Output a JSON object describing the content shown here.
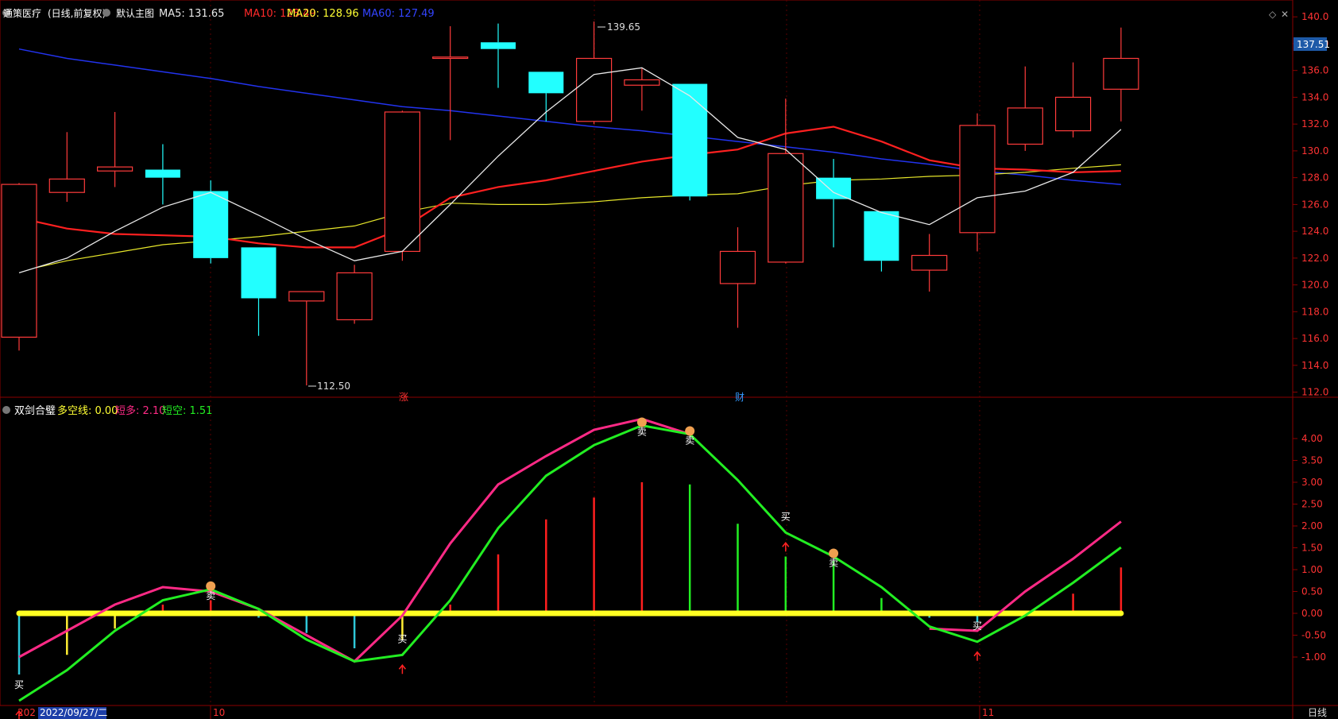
{
  "main": {
    "title": "通策医疗",
    "mode": "(日线,前复权)",
    "indicator_name": "默认主图",
    "ma_labels": [
      {
        "text": "MA5: 131.65",
        "color": "#e8e8e8"
      },
      {
        "text": "MA10: 128.49",
        "color": "#ff2a2a"
      },
      {
        "text": "MA20: 128.96",
        "color": "#ffff33"
      },
      {
        "text": "MA60: 127.49",
        "color": "#3344ff"
      }
    ],
    "price_tag": "137.51",
    "high_mark": "139.65",
    "low_mark": "112.50",
    "event_markers": [
      "涨",
      "财"
    ]
  },
  "sub": {
    "title": "双剑合璧",
    "labels": [
      {
        "text": "多空线: 0.00",
        "color": "#ffff33"
      },
      {
        "text": "短多: 2.10",
        "color": "#ff2a86"
      },
      {
        "text": "短空: 1.51",
        "color": "#22ee22"
      }
    ]
  },
  "signals": {
    "buy": "买",
    "sell": "卖"
  },
  "xaxis": {
    "first_label": "202",
    "cursor_date": "2022/09/27/二",
    "month_labels": [
      "10",
      "11"
    ],
    "period": "日线"
  },
  "chart_data": {
    "type": "candlestick",
    "price_ticks": [
      112,
      114,
      116,
      118,
      120,
      122,
      124,
      126,
      128,
      130,
      132,
      134,
      136,
      138,
      140
    ],
    "osc_ticks": [
      -1,
      -0.5,
      0,
      0.5,
      1,
      1.5,
      2,
      2.5,
      3,
      3.5,
      4
    ],
    "candles": [
      {
        "o": 116.1,
        "h": 127.6,
        "l": 115.1,
        "c": 127.5
      },
      {
        "o": 126.9,
        "h": 131.4,
        "l": 126.2,
        "c": 127.9
      },
      {
        "o": 128.5,
        "h": 132.9,
        "l": 127.3,
        "c": 128.8
      },
      {
        "o": 128.6,
        "h": 130.5,
        "l": 126.0,
        "c": 128.0
      },
      {
        "o": 127.0,
        "h": 127.8,
        "l": 121.6,
        "c": 122.0
      },
      {
        "o": 122.8,
        "h": 122.8,
        "l": 116.2,
        "c": 119.0
      },
      {
        "o": 118.8,
        "h": 119.5,
        "l": 112.5,
        "c": 119.5
      },
      {
        "o": 117.4,
        "h": 121.5,
        "l": 117.1,
        "c": 120.9
      },
      {
        "o": 122.5,
        "h": 133.0,
        "l": 121.8,
        "c": 132.9
      },
      {
        "o": 136.9,
        "h": 139.3,
        "l": 130.8,
        "c": 137.0
      },
      {
        "o": 138.1,
        "h": 139.5,
        "l": 134.7,
        "c": 137.6
      },
      {
        "o": 135.9,
        "h": 135.9,
        "l": 132.2,
        "c": 134.3
      },
      {
        "o": 132.2,
        "h": 139.65,
        "l": 132.0,
        "c": 136.9
      },
      {
        "o": 134.9,
        "h": 136.2,
        "l": 133.0,
        "c": 135.3
      },
      {
        "o": 135.0,
        "h": 135.0,
        "l": 126.3,
        "c": 126.6
      },
      {
        "o": 120.1,
        "h": 124.3,
        "l": 116.8,
        "c": 122.5
      },
      {
        "o": 121.7,
        "h": 133.9,
        "l": 121.6,
        "c": 129.8
      },
      {
        "o": 128.0,
        "h": 129.4,
        "l": 122.8,
        "c": 126.4
      },
      {
        "o": 125.5,
        "h": 125.5,
        "l": 121.0,
        "c": 121.8
      },
      {
        "o": 121.1,
        "h": 123.8,
        "l": 119.5,
        "c": 122.2
      },
      {
        "o": 123.9,
        "h": 132.8,
        "l": 122.5,
        "c": 131.9
      },
      {
        "o": 130.5,
        "h": 136.3,
        "l": 130.0,
        "c": 133.2
      },
      {
        "o": 131.5,
        "h": 136.6,
        "l": 131.0,
        "c": 134.0
      },
      {
        "o": 134.6,
        "h": 139.2,
        "l": 132.2,
        "c": 136.9
      }
    ],
    "ma5": [
      120.9,
      122.0,
      124.0,
      125.8,
      126.9,
      125.2,
      123.4,
      121.8,
      122.5,
      126.0,
      129.6,
      132.9,
      135.7,
      136.2,
      134.1,
      131.0,
      130.1,
      126.9,
      125.4,
      124.5,
      126.5,
      127.0,
      128.4,
      131.6
    ],
    "ma10": [
      125.0,
      124.2,
      123.8,
      123.7,
      123.6,
      123.1,
      122.8,
      122.8,
      124.2,
      126.5,
      127.3,
      127.8,
      128.5,
      129.2,
      129.7,
      130.1,
      131.3,
      131.8,
      130.7,
      129.3,
      128.7,
      128.6,
      128.4,
      128.5
    ],
    "ma20": [
      121.0,
      121.8,
      122.4,
      123.0,
      123.3,
      123.6,
      124.0,
      124.4,
      125.4,
      126.1,
      126.0,
      126.0,
      126.2,
      126.5,
      126.7,
      126.8,
      127.4,
      127.8,
      127.9,
      128.1,
      128.2,
      128.4,
      128.7,
      128.96
    ],
    "ma60": [
      137.6,
      136.9,
      136.4,
      135.9,
      135.4,
      134.8,
      134.3,
      133.8,
      133.3,
      133.0,
      132.6,
      132.2,
      131.8,
      131.5,
      131.1,
      130.7,
      130.3,
      129.9,
      129.4,
      129.0,
      128.5,
      128.2,
      127.8,
      127.49
    ],
    "duanduo": [
      -1.0,
      -0.4,
      0.2,
      0.6,
      0.5,
      0.1,
      -0.5,
      -1.1,
      -0.05,
      1.6,
      2.95,
      3.6,
      4.2,
      4.45,
      4.1,
      null,
      null,
      null,
      null,
      -0.35,
      -0.4,
      0.5,
      1.25,
      2.1
    ],
    "duankong": [
      -2.0,
      -1.3,
      -0.4,
      0.3,
      0.55,
      0.1,
      -0.6,
      -1.1,
      -0.95,
      0.3,
      1.95,
      3.15,
      3.85,
      4.3,
      4.1,
      3.05,
      1.85,
      1.3,
      0.6,
      -0.3,
      -0.65,
      -0.05,
      0.7,
      1.51
    ],
    "bars": [
      -1.4,
      -0.95,
      -0.35,
      0.2,
      0.3,
      -0.1,
      -0.45,
      -0.8,
      -0.6,
      0.2,
      1.35,
      2.15,
      2.65,
      3.0,
      2.95,
      2.05,
      1.3,
      1.2,
      0.35,
      -0.1,
      -0.2,
      0.05,
      0.45,
      1.05
    ],
    "bar_colors": [
      "cyan",
      "yellow",
      "yellow",
      "red",
      "red",
      "cyan",
      "cyan",
      "cyan",
      "yellow",
      "red",
      "red",
      "red",
      "red",
      "red",
      "green",
      "green",
      "green",
      "green",
      "green",
      "cyan",
      "cyan",
      "red",
      "red",
      "red"
    ],
    "signals": [
      {
        "i": 0,
        "type": "buy"
      },
      {
        "i": 4,
        "type": "sell"
      },
      {
        "i": 8,
        "type": "buy"
      },
      {
        "i": 13,
        "type": "sell"
      },
      {
        "i": 14,
        "type": "sell"
      },
      {
        "i": 16,
        "type": "buy"
      },
      {
        "i": 17,
        "type": "sell"
      },
      {
        "i": 20,
        "type": "buy"
      }
    ]
  }
}
